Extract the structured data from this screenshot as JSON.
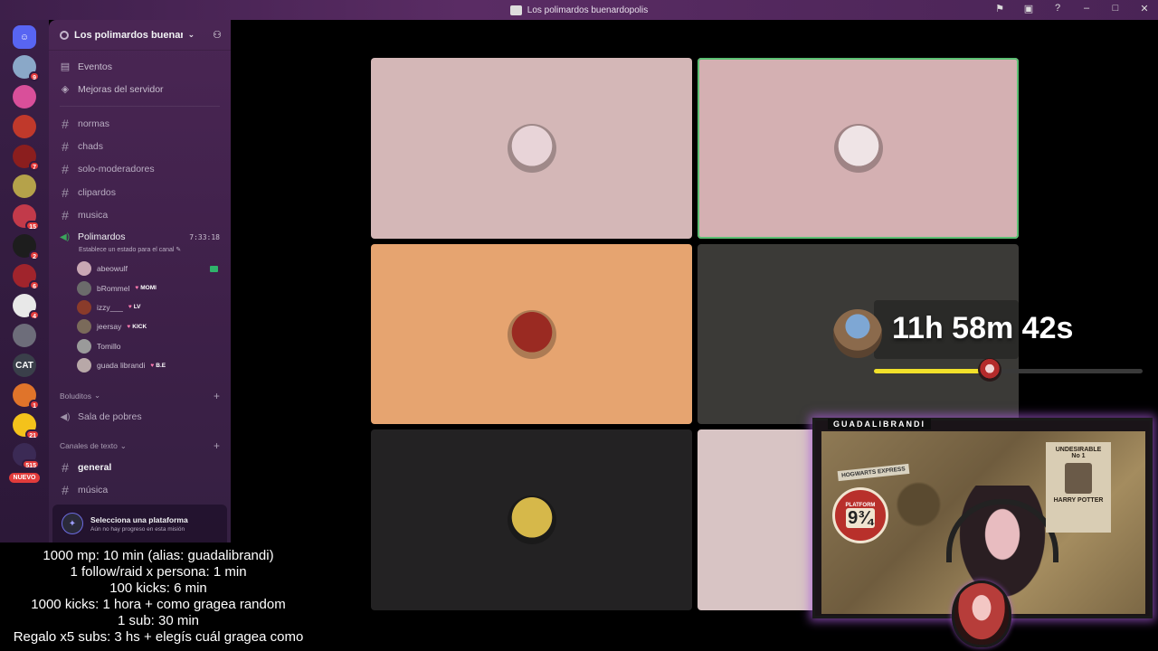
{
  "window": {
    "title": "Los polimardos buenardopolis",
    "controls": [
      "inbox-icon",
      "screen-icon",
      "help-icon",
      "minimize-icon",
      "maximize-icon",
      "close-icon"
    ]
  },
  "rail": {
    "items": [
      {
        "name": "direct-messages",
        "color": "#5865f2",
        "badge": ""
      },
      {
        "name": "server-1",
        "color": "#8aa8c8",
        "badge": "9"
      },
      {
        "name": "server-2",
        "color": "#d94f9a",
        "badge": ""
      },
      {
        "name": "server-3",
        "color": "#c0392b",
        "badge": ""
      },
      {
        "name": "server-4",
        "color": "#8b1e1e",
        "badge": "7"
      },
      {
        "name": "server-5",
        "color": "#b5a24a",
        "badge": ""
      },
      {
        "name": "server-6",
        "color": "#c23a4a",
        "badge": "15"
      },
      {
        "name": "server-7",
        "color": "#1d1d1d",
        "badge": "2"
      },
      {
        "name": "server-8",
        "color": "#a0242c",
        "badge": "6"
      },
      {
        "name": "server-9",
        "color": "#e8e8e8",
        "badge": "4"
      },
      {
        "name": "server-10",
        "color": "#6d6d7a",
        "badge": ""
      },
      {
        "name": "server-cat",
        "color": "#3a3f4a",
        "badge": "",
        "label": "CAT"
      },
      {
        "name": "server-11",
        "color": "#e0742a",
        "badge": "1"
      },
      {
        "name": "server-12",
        "color": "#f4c21b",
        "badge": "21"
      },
      {
        "name": "server-13",
        "color": "#3b2a55",
        "badge": "515"
      }
    ],
    "new_label": "NUEVO"
  },
  "sidebar": {
    "server_name": "Los polimardos buenar...",
    "top_items": [
      {
        "label": "Eventos",
        "icon": "calendar-icon"
      },
      {
        "label": "Mejoras del servidor",
        "icon": "boost-icon"
      }
    ],
    "channels": [
      "normas",
      "chads",
      "solo-moderadores",
      "clipardos",
      "musica"
    ],
    "voice": {
      "name": "Polimardos",
      "timer": "7:33:18",
      "status": "Establece un estado para el canal",
      "members": [
        {
          "name": "abeowulf",
          "tag": "",
          "color": "#c9a8b4"
        },
        {
          "name": "bRommel",
          "tag": "MOMI",
          "color": "#6b6b6b"
        },
        {
          "name": "izzy___",
          "tag": "LV",
          "color": "#8a3b2a"
        },
        {
          "name": "jeersay",
          "tag": "KICK",
          "color": "#7a6a5a"
        },
        {
          "name": "Tomillo",
          "tag": "",
          "color": "#9a9a9a"
        },
        {
          "name": "guada librandi",
          "tag": "B.E",
          "color": "#b8a8a8"
        }
      ]
    },
    "category_1": "Boluditos",
    "voice_2": "Sala de pobres",
    "category_2": "Canales de texto",
    "text_channels": [
      {
        "name": "general",
        "active": true
      },
      {
        "name": "música",
        "active": false
      }
    ],
    "quest": {
      "title": "Selecciona una plataforma",
      "subtitle": "Aún no hay progreso en esta misión"
    }
  },
  "goals": [
    "1000 mp: 10 min (alias: guadalibrandi)",
    "1 follow/raid x persona: 1 min",
    "100 kicks: 6 min",
    "1000 kicks: 1 hora + como gragea random",
    "1 sub: 30 min",
    "Regalo x5 subs: 3 hs + elegís cuál gragea como"
  ],
  "tiles": [
    {
      "bg": "#d4b7b7",
      "avatar": "#e8d4d8",
      "speaking": false
    },
    {
      "bg": "#d4b0b2",
      "avatar": "#efe4e6",
      "speaking": true
    },
    {
      "bg": "#e6a470",
      "avatar": "#9a2a22",
      "speaking": false
    },
    {
      "bg": "#3b3a37",
      "avatar": "",
      "speaking": false
    },
    {
      "bg": "#232223",
      "avatar": "#d6b84a",
      "speaking": false
    },
    {
      "bg": "#d8c4c4",
      "avatar": "",
      "speaking": false
    }
  ],
  "subathon": {
    "time": "11h 58m 42s",
    "progress_fraction": 0.43
  },
  "webcam": {
    "name": "GUADALIBRANDI",
    "sign_top": "PLATFORM",
    "sign_num": "9¾",
    "express_label": "HOGWARTS EXPRESS",
    "poster_title": "UNDESIRABLE",
    "poster_no": "No 1",
    "poster_name": "HARRY POTTER"
  }
}
